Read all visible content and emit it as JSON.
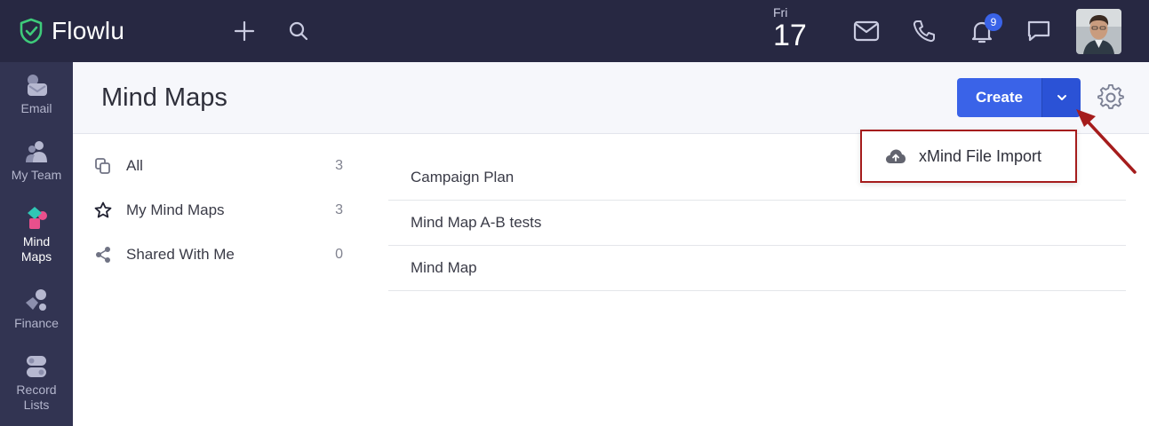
{
  "app": {
    "name": "Flowlu"
  },
  "topbar": {
    "date_day": "Fri",
    "date_num": "17",
    "notification_count": "9",
    "icons": [
      "add-icon",
      "search-icon",
      "mail-icon",
      "phone-icon",
      "bell-icon",
      "chat-icon"
    ]
  },
  "sidebar": {
    "items": [
      {
        "label": "Email",
        "icon": "email-icon"
      },
      {
        "label": "My Team",
        "icon": "team-icon"
      },
      {
        "label": "Mind\nMaps",
        "icon": "mindmap-icon",
        "active": true
      },
      {
        "label": "Finance",
        "icon": "finance-icon"
      },
      {
        "label": "Record\nLists",
        "icon": "record-lists-icon"
      }
    ]
  },
  "header": {
    "title": "Mind Maps",
    "create_label": "Create"
  },
  "dropdown": {
    "item_label": "xMind File Import"
  },
  "filters": [
    {
      "label": "All",
      "count": "3"
    },
    {
      "label": "My Mind Maps",
      "count": "3"
    },
    {
      "label": "Shared With Me",
      "count": "0"
    }
  ],
  "mind_maps": [
    {
      "name": "Campaign Plan"
    },
    {
      "name": "Mind Map A-B tests"
    },
    {
      "name": "Mind Map"
    }
  ],
  "colors": {
    "topbar": "#272842",
    "sidebar": "#323452",
    "accent": "#3a63e8",
    "highlight": "#a51c1c"
  }
}
